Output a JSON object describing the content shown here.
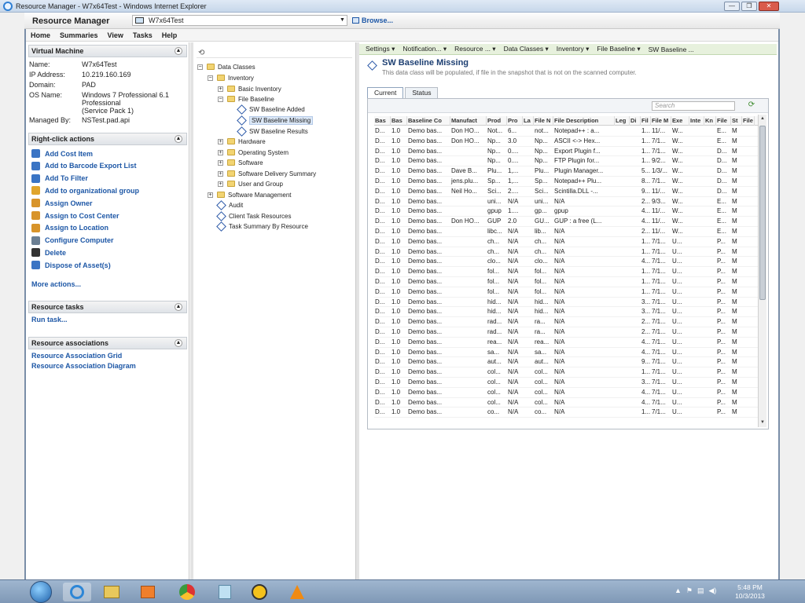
{
  "window": {
    "title": "Resource Manager - W7x64Test - Windows Internet Explorer",
    "buttons": [
      "—",
      "❐",
      "✕"
    ]
  },
  "header": {
    "app_name": "Resource Manager",
    "computer": "W7x64Test",
    "browse_label": "Browse..."
  },
  "menu": [
    "Home",
    "Summaries",
    "View",
    "Tasks",
    "Help"
  ],
  "virtual_machine": {
    "title": "Virtual Machine",
    "fields": [
      {
        "label": "Name:",
        "value": "W7x64Test"
      },
      {
        "label": "IP Address:",
        "value": "10.219.160.169"
      },
      {
        "label": "Domain:",
        "value": "PAD"
      },
      {
        "label": "OS Name:",
        "value": "Windows 7 Professional 6.1"
      },
      {
        "label": "",
        "value": "Professional"
      },
      {
        "label": "",
        "value": "(Service Pack 1)"
      },
      {
        "label": "Managed By:",
        "value": "NSTest.pad.api"
      }
    ]
  },
  "right_click_actions": {
    "title": "Right-click actions",
    "items": [
      {
        "label": "Add Cost Item",
        "color": "#3a74c4"
      },
      {
        "label": "Add to Barcode Export List",
        "color": "#3a74c4"
      },
      {
        "label": "Add To Filter",
        "color": "#3a74c4"
      },
      {
        "label": "Add to organizational group",
        "color": "#e0a52c"
      },
      {
        "label": "Assign Owner",
        "color": "#d8942a"
      },
      {
        "label": "Assign to Cost Center",
        "color": "#d8942a"
      },
      {
        "label": "Assign to Location",
        "color": "#d8942a"
      },
      {
        "label": "Configure Computer",
        "color": "#6b7f93"
      },
      {
        "label": "Delete",
        "color": "#333333"
      },
      {
        "label": "Dispose of Asset(s)",
        "color": "#3a74c4"
      }
    ],
    "more": "More actions..."
  },
  "resource_tasks": {
    "title": "Resource tasks",
    "link": "Run task..."
  },
  "resource_associations": {
    "title": "Resource associations",
    "links": [
      "Resource Association Grid",
      "Resource Association Diagram"
    ]
  },
  "tree": {
    "data_classes": "Data Classes",
    "inventory": "Inventory",
    "basic_inventory": "Basic Inventory",
    "file_baseline": "File Baseline",
    "sw_added": "SW Baseline Added",
    "sw_missing": "SW Baseline Missing",
    "sw_results": "SW Baseline Results",
    "hardware": "Hardware",
    "os": "Operating System",
    "software": "Software",
    "sds": "Software Delivery Summary",
    "user_group": "User and Group",
    "sw_mgmt": "Software Management",
    "audit": "Audit",
    "client_task": "Client Task Resources",
    "task_summary": "Task Summary By Resource"
  },
  "top_tabs": [
    "Settings ▾",
    "Notification... ▾",
    "Resource ... ▾",
    "Data Classes ▾",
    "Inventory ▾",
    "File Baseline ▾",
    "SW Baseline ..."
  ],
  "page": {
    "title": "SW Baseline Missing",
    "subtitle": "This data class will be populated, if file in the snapshot that is not on the scanned computer."
  },
  "sub_tabs": [
    "Current",
    "Status"
  ],
  "search_placeholder": "Search",
  "grid": {
    "columns": [
      "Bas",
      "Bas",
      "Baseline Co",
      "Manufact",
      "Prod",
      "Pro",
      "La",
      "File N",
      "File Description",
      "Leg",
      "Di",
      "Fil",
      "File M",
      "Exe",
      "Inte",
      "Kn",
      "File",
      "St",
      "File"
    ],
    "rows": [
      [
        "D...",
        "1.0",
        "Demo bas...",
        "Don HO...",
        "Not...",
        "6...",
        "",
        "not...",
        "Notepad++ : a...",
        "",
        "",
        "1...",
        "11/...",
        "W...",
        "",
        "",
        "E...",
        "M",
        ""
      ],
      [
        "D...",
        "1.0",
        "Demo bas...",
        "Don HO...",
        "Np...",
        "3.0",
        "",
        "Np...",
        "ASCII <-> Hex...",
        "",
        "",
        "1...",
        "7/1...",
        "W...",
        "",
        "",
        "E...",
        "M",
        ""
      ],
      [
        "D...",
        "1.0",
        "Demo bas...",
        "",
        "Np...",
        "0....",
        "",
        "Np...",
        "Export Plugin f...",
        "",
        "",
        "1...",
        "7/1...",
        "W...",
        "",
        "",
        "D...",
        "M",
        ""
      ],
      [
        "D...",
        "1.0",
        "Demo bas...",
        "",
        "Np...",
        "0....",
        "",
        "Np...",
        "FTP Plugin for...",
        "",
        "",
        "1...",
        "9/2...",
        "W...",
        "",
        "",
        "D...",
        "M",
        ""
      ],
      [
        "D...",
        "1.0",
        "Demo bas...",
        "Dave B...",
        "Plu...",
        "1,...",
        "",
        "Plu...",
        "Plugin Manager...",
        "",
        "",
        "5...",
        "1/3/...",
        "W...",
        "",
        "",
        "D...",
        "M",
        ""
      ],
      [
        "D...",
        "1.0",
        "Demo bas...",
        "jens.plu...",
        "Sp...",
        "1,...",
        "",
        "Sp...",
        "Notepad++ Plu...",
        "",
        "",
        "8...",
        "7/1...",
        "W...",
        "",
        "",
        "D...",
        "M",
        ""
      ],
      [
        "D...",
        "1.0",
        "Demo bas...",
        "Neil Ho...",
        "Sci...",
        "2....",
        "",
        "Sci...",
        "Scintilla.DLL -...",
        "",
        "",
        "9...",
        "11/...",
        "W...",
        "",
        "",
        "D...",
        "M",
        ""
      ],
      [
        "D...",
        "1.0",
        "Demo bas...",
        "",
        "uni...",
        "N/A",
        "",
        "uni...",
        "N/A",
        "",
        "",
        "2...",
        "9/3...",
        "W...",
        "",
        "",
        "E...",
        "M",
        ""
      ],
      [
        "D...",
        "1.0",
        "Demo bas...",
        "",
        "gpup",
        "1....",
        "",
        "gp...",
        "gpup",
        "",
        "",
        "4...",
        "11/...",
        "W...",
        "",
        "",
        "E...",
        "M",
        ""
      ],
      [
        "D...",
        "1.0",
        "Demo bas...",
        "Don HO...",
        "GUP",
        "2.0",
        "",
        "GU...",
        "GUP : a free (L...",
        "",
        "",
        "4...",
        "11/...",
        "W...",
        "",
        "",
        "E...",
        "M",
        ""
      ],
      [
        "D...",
        "1.0",
        "Demo bas...",
        "",
        "libc...",
        "N/A",
        "",
        "lib...",
        "N/A",
        "",
        "",
        "2...",
        "11/...",
        "W...",
        "",
        "",
        "E...",
        "M",
        ""
      ],
      [
        "D...",
        "1.0",
        "Demo bas...",
        "",
        "ch...",
        "N/A",
        "",
        "ch...",
        "N/A",
        "",
        "",
        "1...",
        "7/1...",
        "U...",
        "",
        "",
        "P...",
        "M",
        ""
      ],
      [
        "D...",
        "1.0",
        "Demo bas...",
        "",
        "ch...",
        "N/A",
        "",
        "ch...",
        "N/A",
        "",
        "",
        "1...",
        "7/1...",
        "U...",
        "",
        "",
        "P...",
        "M",
        ""
      ],
      [
        "D...",
        "1.0",
        "Demo bas...",
        "",
        "clo...",
        "N/A",
        "",
        "clo...",
        "N/A",
        "",
        "",
        "4...",
        "7/1...",
        "U...",
        "",
        "",
        "P...",
        "M",
        ""
      ],
      [
        "D...",
        "1.0",
        "Demo bas...",
        "",
        "fol...",
        "N/A",
        "",
        "fol...",
        "N/A",
        "",
        "",
        "1...",
        "7/1...",
        "U...",
        "",
        "",
        "P...",
        "M",
        ""
      ],
      [
        "D...",
        "1.0",
        "Demo bas...",
        "",
        "fol...",
        "N/A",
        "",
        "fol...",
        "N/A",
        "",
        "",
        "1...",
        "7/1...",
        "U...",
        "",
        "",
        "P...",
        "M",
        ""
      ],
      [
        "D...",
        "1.0",
        "Demo bas...",
        "",
        "fol...",
        "N/A",
        "",
        "fol...",
        "N/A",
        "",
        "",
        "1...",
        "7/1...",
        "U...",
        "",
        "",
        "P...",
        "M",
        ""
      ],
      [
        "D...",
        "1.0",
        "Demo bas...",
        "",
        "hid...",
        "N/A",
        "",
        "hid...",
        "N/A",
        "",
        "",
        "3...",
        "7/1...",
        "U...",
        "",
        "",
        "P...",
        "M",
        ""
      ],
      [
        "D...",
        "1.0",
        "Demo bas...",
        "",
        "hid...",
        "N/A",
        "",
        "hid...",
        "N/A",
        "",
        "",
        "3...",
        "7/1...",
        "U...",
        "",
        "",
        "P...",
        "M",
        ""
      ],
      [
        "D...",
        "1.0",
        "Demo bas...",
        "",
        "rad...",
        "N/A",
        "",
        "ra...",
        "N/A",
        "",
        "",
        "2...",
        "7/1...",
        "U...",
        "",
        "",
        "P...",
        "M",
        ""
      ],
      [
        "D...",
        "1.0",
        "Demo bas...",
        "",
        "rad...",
        "N/A",
        "",
        "ra...",
        "N/A",
        "",
        "",
        "2...",
        "7/1...",
        "U...",
        "",
        "",
        "P...",
        "M",
        ""
      ],
      [
        "D...",
        "1.0",
        "Demo bas...",
        "",
        "rea...",
        "N/A",
        "",
        "rea...",
        "N/A",
        "",
        "",
        "4...",
        "7/1...",
        "U...",
        "",
        "",
        "P...",
        "M",
        ""
      ],
      [
        "D...",
        "1.0",
        "Demo bas...",
        "",
        "sa...",
        "N/A",
        "",
        "sa...",
        "N/A",
        "",
        "",
        "4...",
        "7/1...",
        "U...",
        "",
        "",
        "P...",
        "M",
        ""
      ],
      [
        "D...",
        "1.0",
        "Demo bas...",
        "",
        "aut...",
        "N/A",
        "",
        "aut...",
        "N/A",
        "",
        "",
        "9...",
        "7/1...",
        "U...",
        "",
        "",
        "P...",
        "M",
        ""
      ],
      [
        "D...",
        "1.0",
        "Demo bas...",
        "",
        "col...",
        "N/A",
        "",
        "col...",
        "N/A",
        "",
        "",
        "1...",
        "7/1...",
        "U...",
        "",
        "",
        "P...",
        "M",
        ""
      ],
      [
        "D...",
        "1.0",
        "Demo bas...",
        "",
        "col...",
        "N/A",
        "",
        "col...",
        "N/A",
        "",
        "",
        "3...",
        "7/1...",
        "U...",
        "",
        "",
        "P...",
        "M",
        ""
      ],
      [
        "D...",
        "1.0",
        "Demo bas...",
        "",
        "col...",
        "N/A",
        "",
        "col...",
        "N/A",
        "",
        "",
        "4...",
        "7/1...",
        "U...",
        "",
        "",
        "P...",
        "M",
        ""
      ],
      [
        "D...",
        "1.0",
        "Demo bas...",
        "",
        "col...",
        "N/A",
        "",
        "col...",
        "N/A",
        "",
        "",
        "4...",
        "7/1...",
        "U...",
        "",
        "",
        "P...",
        "M",
        ""
      ],
      [
        "D...",
        "1.0",
        "Demo bas...",
        "",
        "co...",
        "N/A",
        "",
        "co...",
        "N/A",
        "",
        "",
        "1...",
        "7/1...",
        "U...",
        "",
        "",
        "P...",
        "M",
        ""
      ]
    ]
  },
  "taskbar": {
    "time": "5:48 PM",
    "date": "10/3/2013"
  }
}
